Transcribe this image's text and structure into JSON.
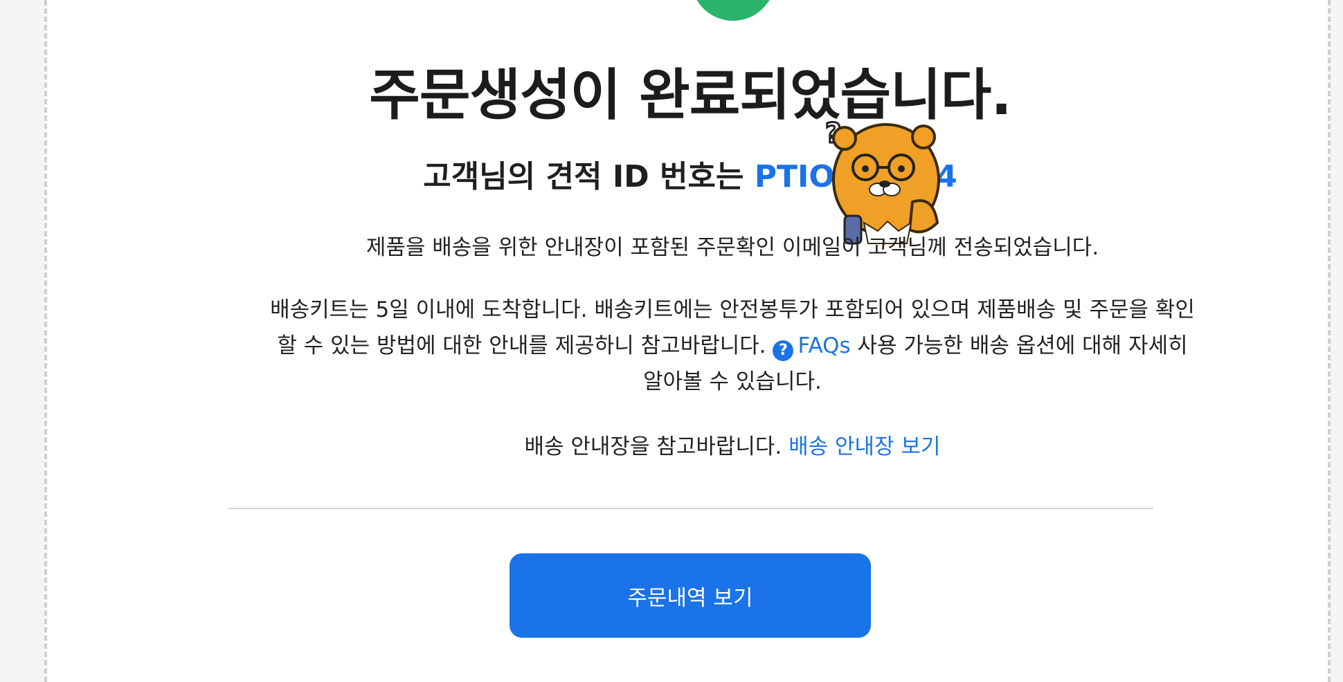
{
  "header": {
    "title": "주문생성이 완료되었습니다.",
    "subtitle_prefix": "고객님의 견적 ID 번호는 ",
    "quote_id": "PTIOOC    034"
  },
  "body": {
    "paragraph1": "제품을 배송을 위한 안내장이 포함된 주문확인 이메일이 고객님께 전송되었습니다.",
    "paragraph2_before": "배송키트는 5일 이내에 도착합니다. 배송키트에는 안전봉투가 포함되어 있으며 제품배송 및 주문을 확인 할 수 있는 방법에 대한 안내를 제공하니 참고바랍니다. ",
    "help_icon_glyph": "?",
    "faq_link": "FAQs",
    "paragraph2_after": " 사용 가능한 배송 옵션에 대해 자세히 알아볼 수 있습니다.",
    "paragraph3_text": "배송 안내장을 참고바랍니다. ",
    "shipping_guide_link": "배송 안내장 보기"
  },
  "actions": {
    "order_history_button": "주문내역 보기"
  },
  "icons": {
    "success": "success-circle",
    "help": "question-circle-icon",
    "mascot": "ryan-mascot-sticker"
  },
  "colors": {
    "accent": "#1a73e8",
    "success": "#2cb36b",
    "text": "#1f1f1f"
  }
}
